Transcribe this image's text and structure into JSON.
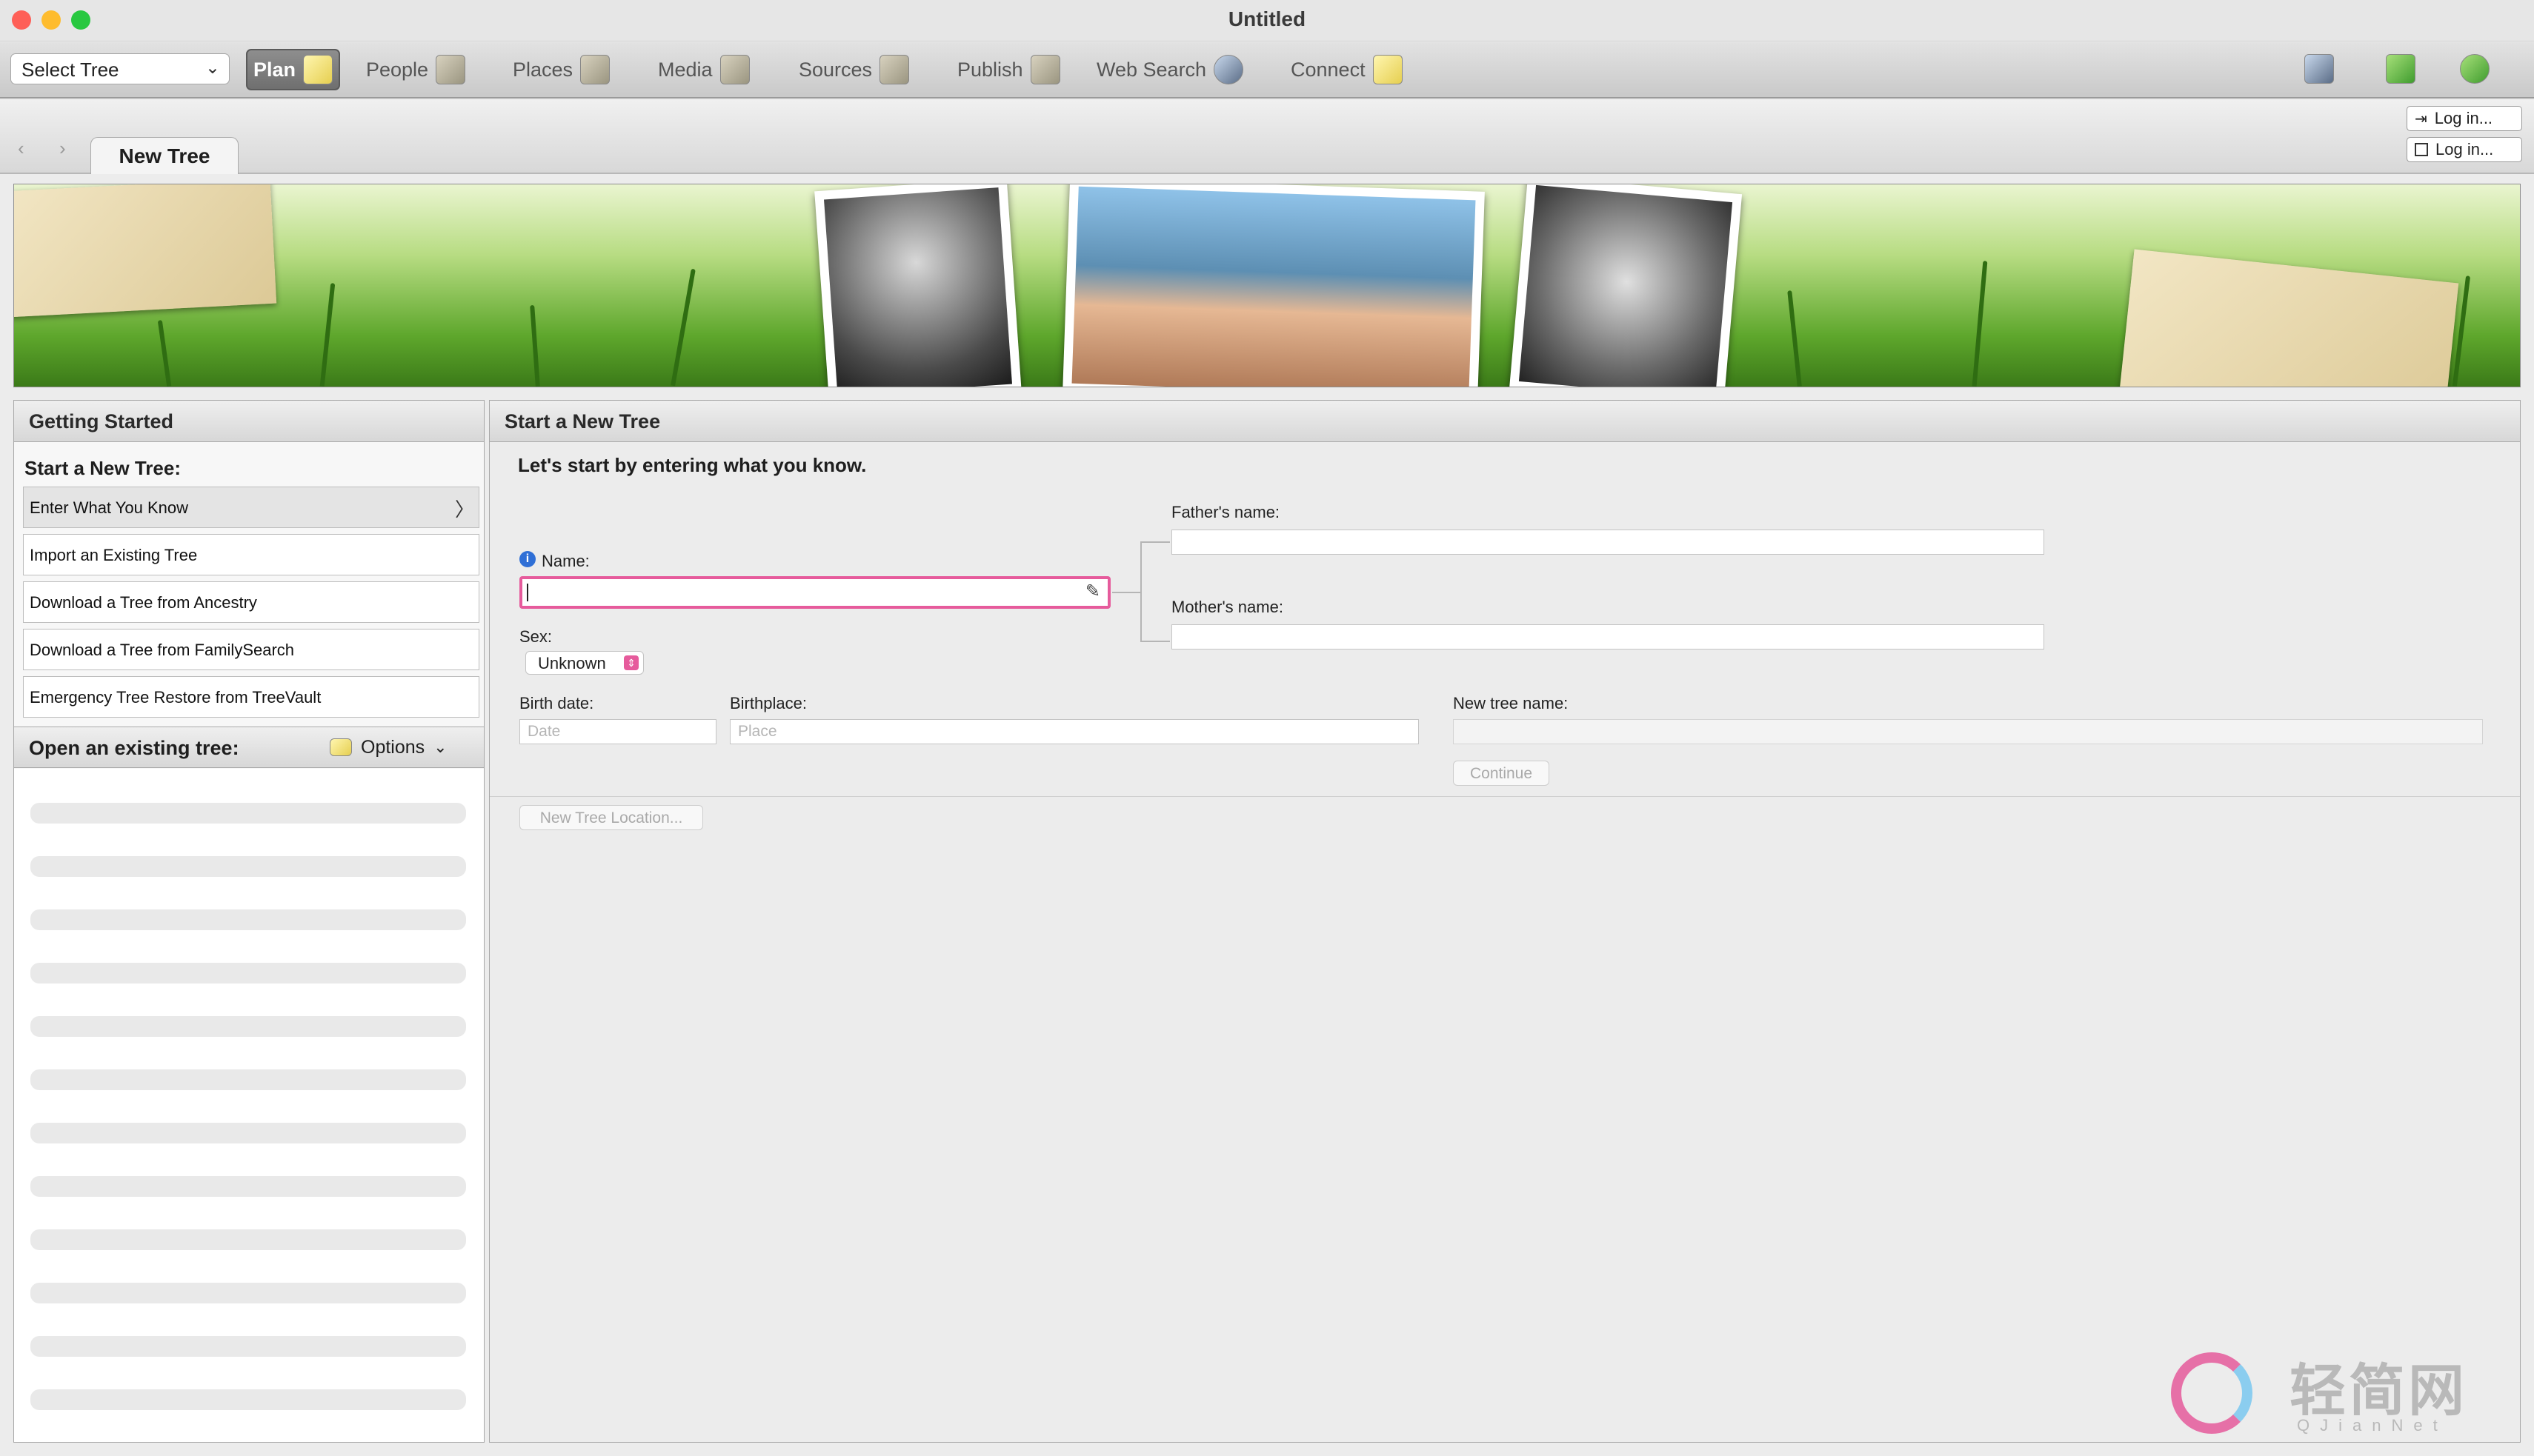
{
  "window": {
    "title": "Untitled"
  },
  "toolbar": {
    "tree_select": "Select Tree",
    "items": [
      {
        "label": "Plan",
        "icon": "plan-icon"
      },
      {
        "label": "People",
        "icon": "people-icon"
      },
      {
        "label": "Places",
        "icon": "places-icon"
      },
      {
        "label": "Media",
        "icon": "media-icon"
      },
      {
        "label": "Sources",
        "icon": "sources-icon"
      },
      {
        "label": "Publish",
        "icon": "publish-icon"
      },
      {
        "label": "Web Search",
        "icon": "web-search-icon"
      },
      {
        "label": "Connect",
        "icon": "connect-icon"
      }
    ]
  },
  "tabs": {
    "active": "New Tree"
  },
  "accounts": {
    "login_1": "Log in...",
    "login_2": "Log in..."
  },
  "sidebar": {
    "header": "Getting Started",
    "start_title": "Start a New Tree:",
    "start_items": [
      "Enter What You Know",
      "Import an Existing Tree",
      "Download a Tree from Ancestry",
      "Download a Tree from FamilySearch",
      "Emergency Tree Restore from TreeVault"
    ],
    "open_title": "Open an existing tree:",
    "options_label": "Options"
  },
  "main": {
    "header": "Start a New Tree",
    "intro": "Let's start by entering what you know.",
    "name_label": "Name:",
    "sex_label": "Sex:",
    "sex_value": "Unknown",
    "father_label": "Father's name:",
    "mother_label": "Mother's name:",
    "birth_date_label": "Birth date:",
    "birth_date_placeholder": "Date",
    "birthplace_label": "Birthplace:",
    "birthplace_placeholder": "Place",
    "tree_name_label": "New tree name:",
    "continue_label": "Continue",
    "location_label": "New Tree Location..."
  },
  "watermark": {
    "text": "轻简网",
    "subtext": "QJianNet"
  },
  "colors": {
    "accent": "#e65b9c",
    "info": "#2f6fd6",
    "close": "#fe5f57",
    "minimize": "#febc2e",
    "maximize": "#28c840"
  }
}
